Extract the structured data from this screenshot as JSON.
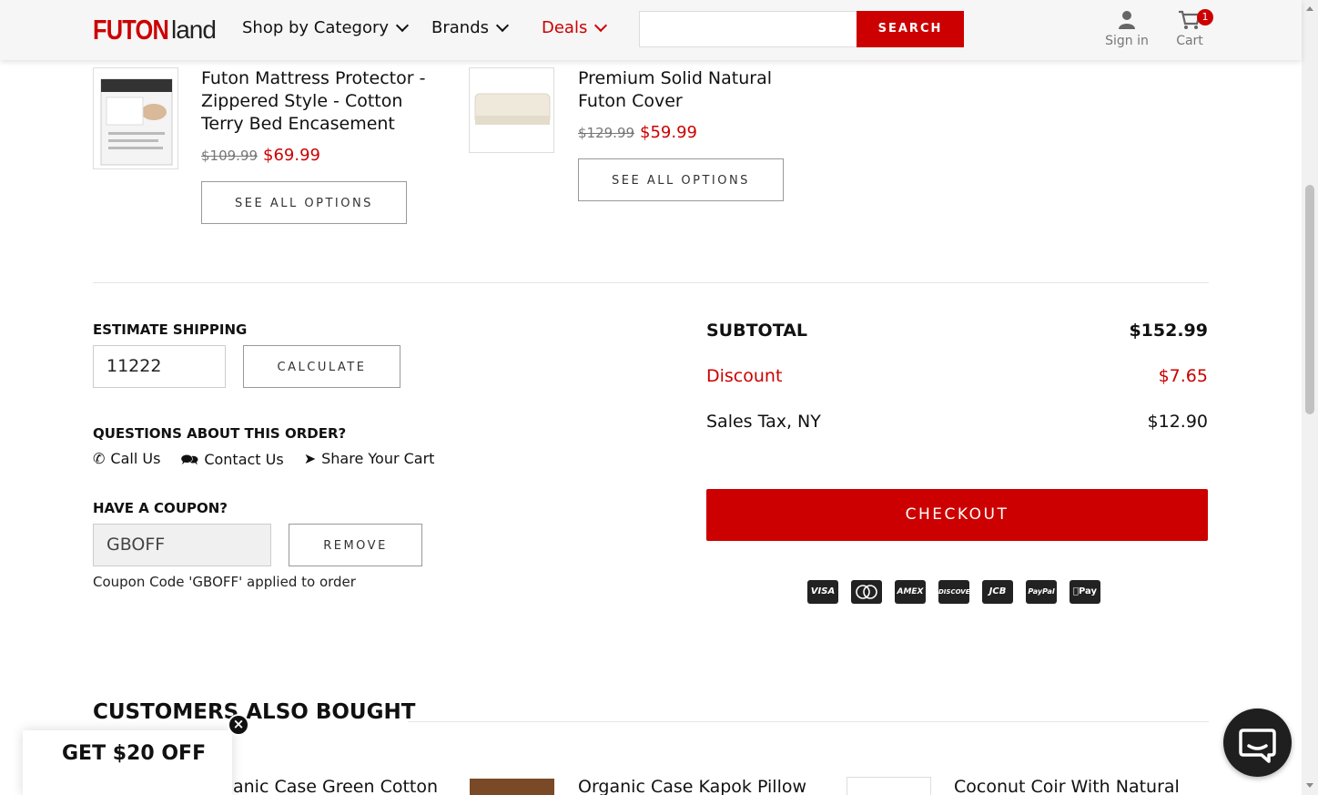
{
  "header": {
    "logo": "FUTONland",
    "nav": [
      "Shop by Category",
      "Brands",
      "Deals"
    ],
    "search_placeholder": "",
    "search_button": "SEARCH",
    "sign_in": "Sign in",
    "cart": "Cart",
    "cart_count": "1"
  },
  "recommended": [
    {
      "name_lines": [
        "Futon Mattress Protector -",
        "Zippered Style - Cotton",
        "Terry Bed Encasement"
      ],
      "old_price": "$109.99",
      "price": "$69.99",
      "button": "SEE ALL OPTIONS"
    },
    {
      "name_lines": [
        "Premium Solid Natural",
        "Futon Cover"
      ],
      "old_price": "$129.99",
      "price": "$59.99",
      "button": "SEE ALL OPTIONS"
    }
  ],
  "shipping": {
    "label": "ESTIMATE SHIPPING",
    "zip": "11222",
    "button": "CALCULATE"
  },
  "questions": {
    "label": "QUESTIONS ABOUT THIS ORDER?",
    "links": [
      "Call Us",
      "Contact Us",
      "Share Your Cart"
    ]
  },
  "coupon": {
    "label": "HAVE A COUPON?",
    "code": "GBOFF",
    "button": "REMOVE",
    "note": "Coupon Code 'GBOFF' applied to order"
  },
  "summary": {
    "subtotal_label": "SUBTOTAL",
    "subtotal": "$152.99",
    "discount_label": "Discount",
    "discount": "$7.65",
    "tax_label": "Sales Tax, NY",
    "tax": "$12.90",
    "checkout": "CHECKOUT"
  },
  "payment_icons": [
    "VISA",
    "MC",
    "AMEX",
    "DISCOVER",
    "JCB",
    "PayPal",
    "Pay"
  ],
  "also_bought": {
    "title": "CUSTOMERS ALSO BOUGHT",
    "items": [
      "anic Case Green Cotton",
      "Organic Case Kapok Pillow",
      "Coconut Coir With Natural"
    ]
  },
  "popup": {
    "text": "GET $20 OFF",
    "close": "×"
  },
  "colors": {
    "brand": "#cc0000"
  }
}
